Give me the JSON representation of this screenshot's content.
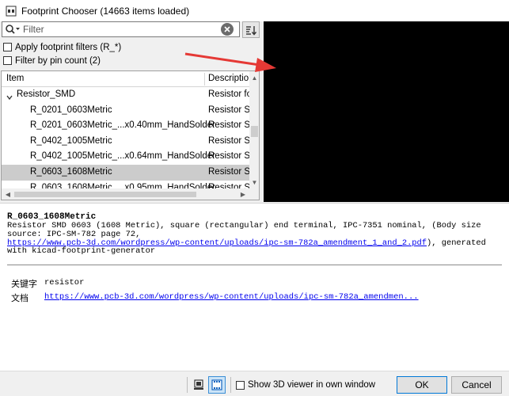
{
  "window": {
    "title": "Footprint Chooser (14663 items loaded)"
  },
  "filter": {
    "placeholder": "Filter",
    "value": ""
  },
  "options": {
    "apply_filters_label": "Apply footprint filters (R_*)",
    "filter_pins_label": "Filter by pin count (2)"
  },
  "tree": {
    "col_item": "Item",
    "col_description": "Descriptio",
    "rows": [
      {
        "name": "Resistor_SMD",
        "desc": "Resistor fo",
        "level": 0,
        "expanded": true,
        "selected": false
      },
      {
        "name": "R_0201_0603Metric",
        "desc": "Resistor SM",
        "level": 1,
        "selected": false
      },
      {
        "name": "R_0201_0603Metric_...x0.40mm_HandSolder",
        "desc": "Resistor SM",
        "level": 1,
        "selected": false
      },
      {
        "name": "R_0402_1005Metric",
        "desc": "Resistor SM",
        "level": 1,
        "selected": false
      },
      {
        "name": "R_0402_1005Metric_...x0.64mm_HandSolder",
        "desc": "Resistor SM",
        "level": 1,
        "selected": false
      },
      {
        "name": "R_0603_1608Metric",
        "desc": "Resistor SM",
        "level": 1,
        "selected": true
      },
      {
        "name": "R_0603_1608Metric_...x0.95mm_HandSolder",
        "desc": "Resistor SM",
        "level": 1,
        "selected": false
      }
    ]
  },
  "details": {
    "name": "R_0603_1608Metric",
    "desc_before": "Resistor SMD 0603 (1608 Metric), square (rectangular) end terminal, IPC-7351 nominal, (Body size source: IPC-SM-782 page 72,",
    "desc_link": "https://www.pcb-3d.com/wordpress/wp-content/uploads/ipc-sm-782a_amendment_1_and_2.pdf",
    "desc_after": "), generated with kicad-footprint-generator",
    "keywords_label": "关键字",
    "keywords_value": "resistor",
    "doc_label": "文档",
    "doc_link": "https://www.pcb-3d.com/wordpress/wp-content/uploads/ipc-sm-782a_amendmen..."
  },
  "bottom": {
    "show3d_label": "Show 3D viewer in own window",
    "ok_label": "OK",
    "cancel_label": "Cancel"
  },
  "colors": {
    "arrow": "#e53935",
    "link": "#0000ee",
    "selected_row": "#cccccc"
  }
}
